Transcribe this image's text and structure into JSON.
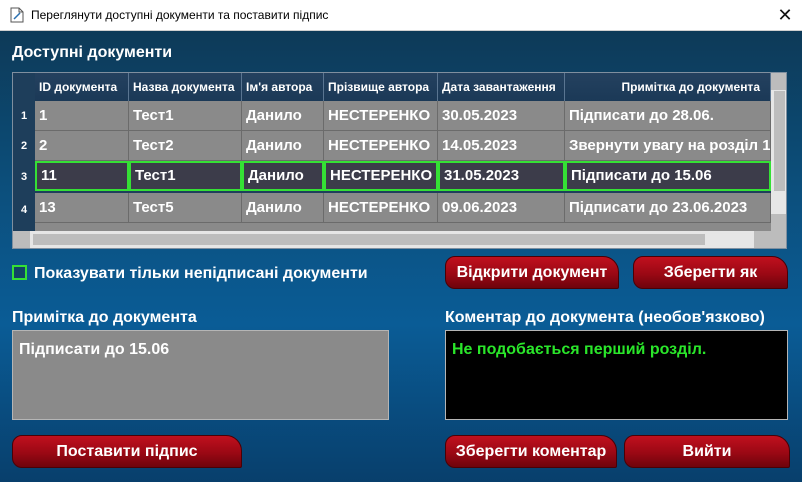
{
  "window": {
    "title": "Переглянути доступні документи та поставити підпис",
    "close_glyph": "✕",
    "icon": "document-edit-icon"
  },
  "documents": {
    "heading": "Доступні документи",
    "columns": [
      "ID документа",
      "Назва документа",
      "Ім'я автора",
      "Прізвище автора",
      "Дата завантаження",
      "Примітка до документа"
    ],
    "rows": [
      {
        "num": "1",
        "cells": [
          "1",
          "Тест1",
          "Данило",
          "НЕСТЕРЕНКО",
          "30.05.2023",
          "Підписати до 28.06."
        ]
      },
      {
        "num": "2",
        "cells": [
          "2",
          "Тест2",
          "Данило",
          "НЕСТЕРЕНКО",
          "14.05.2023",
          "Звернути увагу на розділ 1."
        ]
      },
      {
        "num": "3",
        "cells": [
          "11",
          "Тест1",
          "Данило",
          "НЕСТЕРЕНКО",
          "31.05.2023",
          "Підписати до 15.06"
        ],
        "selected": true
      },
      {
        "num": "4",
        "cells": [
          "13",
          "Тест5",
          "Данило",
          "НЕСТЕРЕНКО",
          "09.06.2023",
          "Підписати до 23.06.2023"
        ]
      }
    ]
  },
  "filter": {
    "label": "Показувати тільки непідписані документи",
    "checked": false
  },
  "buttons": {
    "open": "Відкрити документ",
    "save_as": "Зберегти як",
    "sign": "Поставити підпис",
    "save_comment": "Зберегти коментар",
    "exit": "Вийти"
  },
  "note": {
    "heading": "Примітка до документа",
    "value": "Підписати до 15.06"
  },
  "comment": {
    "heading": "Коментар до документа (необов'язково)",
    "value": "Не подобається перший розділ."
  },
  "colors": {
    "accent_green": "#35e035",
    "button_red": "#b00c18",
    "background_blue": "#0a5c96"
  }
}
